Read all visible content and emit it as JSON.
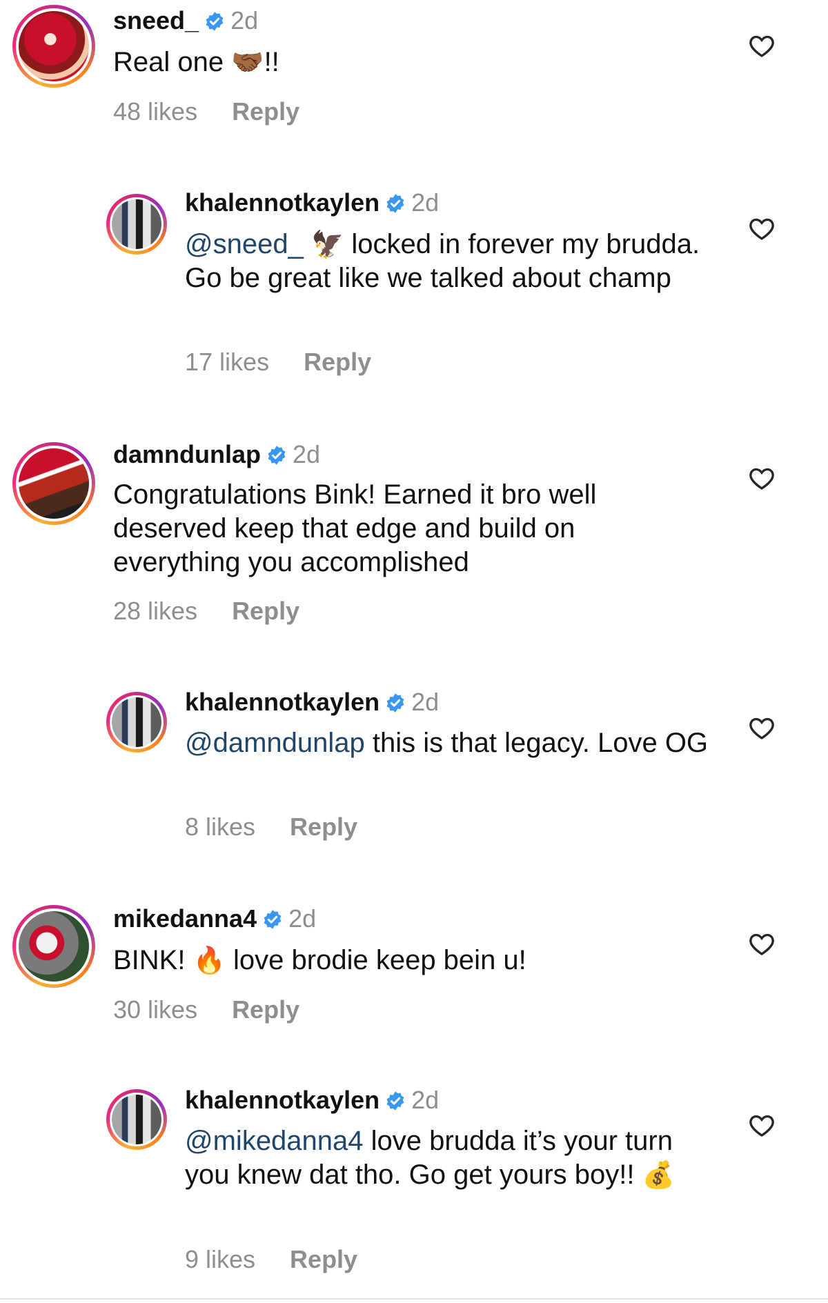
{
  "comments": [
    {
      "username": "sneed_",
      "age": "2d",
      "text_parts": {
        "before": "Real one ",
        "emoji": "🤝🏾",
        "after": "!!"
      },
      "likes": "48 likes",
      "reply_label": "Reply",
      "avatar_icon": "avatar-photo"
    },
    {
      "username": "khalennotkaylen",
      "age": "2d",
      "mention": "@sneed_",
      "text_parts": {
        "emoji": "🦅",
        "after": " locked in forever my brudda. Go be great like we talked about champ"
      },
      "likes": "17 likes",
      "reply_label": "Reply",
      "avatar_icon": "avatar-photo"
    },
    {
      "username": "damndunlap",
      "age": "2d",
      "text": "Congratulations Bink! Earned it bro well deserved keep that edge and build on everything you accomplished",
      "likes": "28 likes",
      "reply_label": "Reply",
      "avatar_icon": "avatar-photo"
    },
    {
      "username": "khalennotkaylen",
      "age": "2d",
      "mention": "@damndunlap",
      "text": " this is that legacy. Love OG",
      "likes": "8 likes",
      "reply_label": "Reply",
      "avatar_icon": "avatar-photo"
    },
    {
      "username": "mikedanna4",
      "age": "2d",
      "text_parts": {
        "before": "BINK! ",
        "emoji": "🔥",
        "after": " love brodie keep bein u!"
      },
      "likes": "30 likes",
      "reply_label": "Reply",
      "avatar_icon": "avatar-photo"
    },
    {
      "username": "khalennotkaylen",
      "age": "2d",
      "mention": "@mikedanna4",
      "text_parts": {
        "after": " love brudda it’s your turn you knew dat tho. Go get yours boy!! ",
        "emoji": "💰"
      },
      "likes": "9 likes",
      "reply_label": "Reply",
      "avatar_icon": "avatar-photo"
    }
  ],
  "icons": {
    "verified": "verified-badge-icon",
    "like": "heart-outline-icon"
  },
  "colors": {
    "verified_blue": "#3897f0",
    "mention_blue": "#20456b",
    "meta_gray": "#8e8e8e"
  }
}
